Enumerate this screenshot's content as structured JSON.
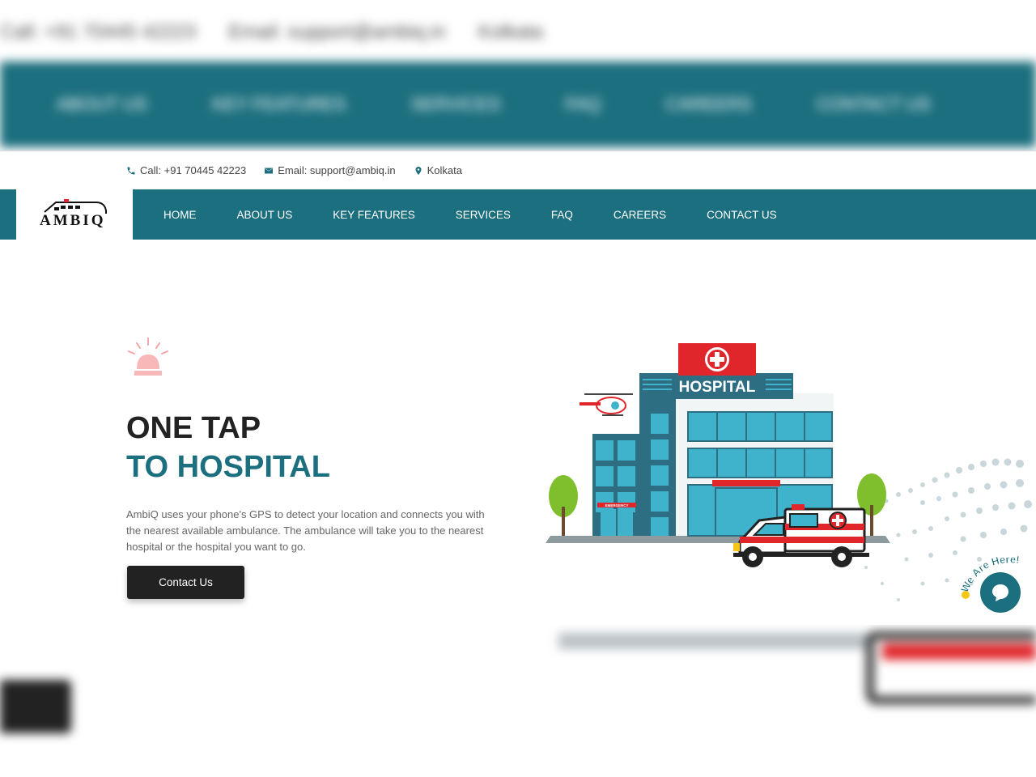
{
  "topbar": {
    "call": "Call: +91 70445 42223",
    "email": "Email: support@ambiq.in",
    "location": "Kolkata"
  },
  "logo": {
    "text": "AMBIQ"
  },
  "nav": {
    "items": [
      {
        "label": "HOME"
      },
      {
        "label": "ABOUT US"
      },
      {
        "label": "KEY FEATURES"
      },
      {
        "label": "SERVICES"
      },
      {
        "label": "FAQ"
      },
      {
        "label": "CAREERS"
      },
      {
        "label": "CONTACT US"
      }
    ]
  },
  "hero": {
    "title_line1": "ONE TAP",
    "title_line2": "TO HOSPITAL",
    "description": "AmbiQ uses your phone's GPS to detect your location and connects you with the nearest available ambulance. The ambulance will take you to the nearest hospital or the hospital you want to go.",
    "cta_label": "Contact Us"
  },
  "illustration": {
    "hospital_sign": "HOSPITAL",
    "emergency_sign": "EMERGENCY"
  },
  "chat_widget": {
    "label": "We Are Here!"
  },
  "colors": {
    "primary": "#1c6f7e",
    "dark": "#222222",
    "red": "#e0262b"
  }
}
